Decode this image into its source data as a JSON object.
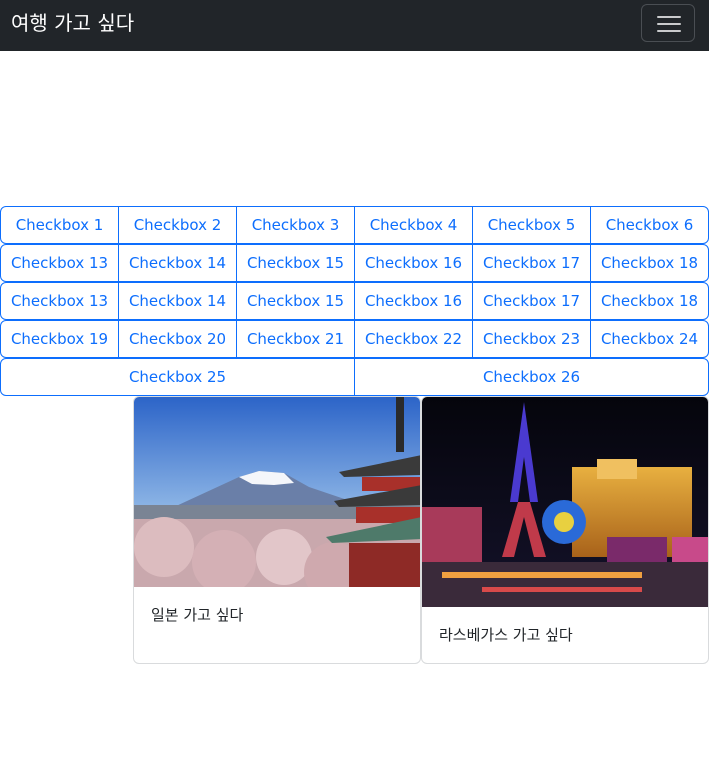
{
  "navbar": {
    "brand": "여행 가고 싶다",
    "toggler_icon": "hamburger-icon"
  },
  "checkbox_rows": [
    [
      "Checkbox 1",
      "Checkbox 2",
      "Checkbox 3",
      "Checkbox 4",
      "Checkbox 5",
      "Checkbox 6"
    ],
    [
      "Checkbox 13",
      "Checkbox 14",
      "Checkbox 15",
      "Checkbox 16",
      "Checkbox 17",
      "Checkbox 18"
    ],
    [
      "Checkbox 13",
      "Checkbox 14",
      "Checkbox 15",
      "Checkbox 16",
      "Checkbox 17",
      "Checkbox 18"
    ],
    [
      "Checkbox 19",
      "Checkbox 20",
      "Checkbox 21",
      "Checkbox 22",
      "Checkbox 23",
      "Checkbox 24"
    ],
    [
      "Checkbox 25",
      "Checkbox 26"
    ]
  ],
  "cards": [
    {
      "text": "일본 가고 싶다"
    },
    {
      "text": "라스베가스 가고 싶다"
    }
  ],
  "colors": {
    "navbar_bg": "#212529",
    "accent": "#0d6efd"
  }
}
